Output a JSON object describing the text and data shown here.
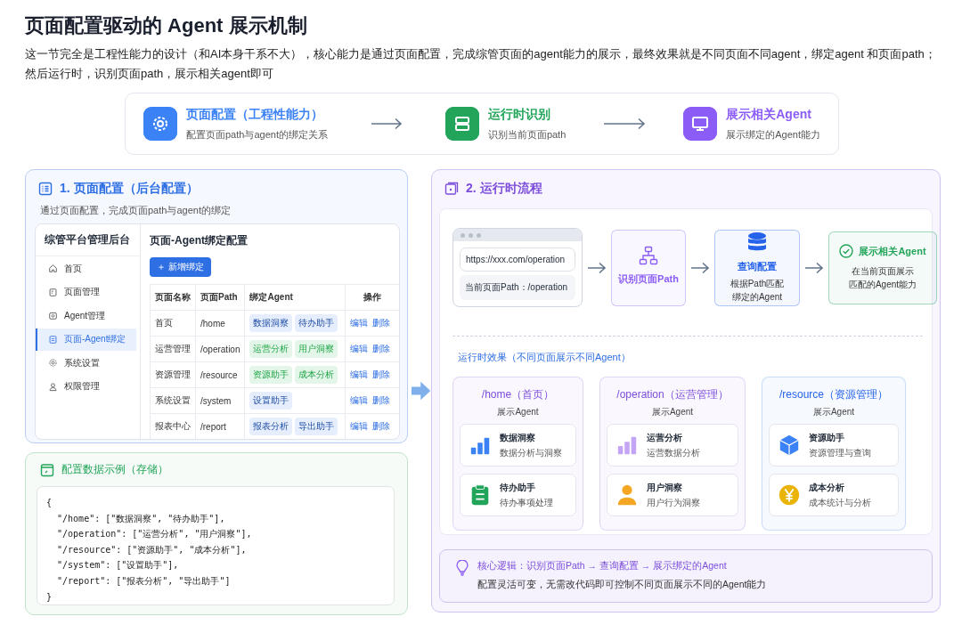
{
  "title": "页面配置驱动的 Agent 展示机制",
  "intro": "这一节完全是工程性能力的设计（和AI本身干系不大），核心能力是通过页面配置，完成综管页面的agent能力的展示，最终效果就是不同页面不同agent，绑定agent 和页面path；然后运行时，识别页面path，展示相关agent即可",
  "overview_steps": [
    {
      "title": "页面配置（工程性能力）",
      "desc": "配置页面path与agent的绑定关系",
      "color": "#3b82f6"
    },
    {
      "title": "运行时识别",
      "desc": "识别当前页面path",
      "color": "#22a55a"
    },
    {
      "title": "展示相关Agent",
      "desc": "展示绑定的Agent能力",
      "color": "#8b5cf6"
    }
  ],
  "config_panel": {
    "title": "1. 页面配置（后台配置）",
    "subtitle": "通过页面配置，完成页面path与agent的绑定",
    "admin": {
      "app_title": "综管平台管理后台",
      "sidebar": [
        {
          "label": "首页",
          "selected": false
        },
        {
          "label": "页面管理",
          "selected": false
        },
        {
          "label": "Agent管理",
          "selected": false
        },
        {
          "label": "页面-Agent绑定",
          "selected": true
        },
        {
          "label": "系统设置",
          "selected": false
        },
        {
          "label": "权限管理",
          "selected": false
        }
      ],
      "page_title": "页面-Agent绑定配置",
      "add_button": "＋ 新增绑定",
      "table": {
        "columns": [
          "页面名称",
          "页面Path",
          "绑定Agent",
          "操作"
        ],
        "rows": [
          {
            "name": "首页",
            "path": "/home",
            "agents": [
              {
                "label": "数据洞察",
                "color": "#e6eefd"
              },
              {
                "label": "待办助手",
                "color": "#e6eefd"
              }
            ],
            "actions": [
              "编辑",
              "删除"
            ]
          },
          {
            "name": "运营管理",
            "path": "/operation",
            "agents": [
              {
                "label": "运营分析",
                "color": "#e4f5e9"
              },
              {
                "label": "用户洞察",
                "color": "#e4f5e9"
              }
            ],
            "actions": [
              "编辑",
              "删除"
            ]
          },
          {
            "name": "资源管理",
            "path": "/resource",
            "agents": [
              {
                "label": "资源助手",
                "color": "#e4f5e9"
              },
              {
                "label": "成本分析",
                "color": "#e4f5e9"
              }
            ],
            "actions": [
              "编辑",
              "删除"
            ]
          },
          {
            "name": "系统设置",
            "path": "/system",
            "agents": [
              {
                "label": "设置助手",
                "color": "#e6eefd"
              }
            ],
            "actions": [
              "编辑",
              "删除"
            ]
          },
          {
            "name": "报表中心",
            "path": "/report",
            "agents": [
              {
                "label": "报表分析",
                "color": "#e6eefd"
              },
              {
                "label": "导出助手",
                "color": "#e6eefd"
              }
            ],
            "actions": [
              "编辑",
              "删除"
            ]
          }
        ]
      }
    }
  },
  "storage_panel": {
    "title": "配置数据示例（存储）",
    "code_lines": [
      "{",
      "  \"/home\": [\"数据洞察\", \"待办助手\"],",
      "  \"/operation\": [\"运营分析\", \"用户洞察\"],",
      "  \"/resource\": [\"资源助手\", \"成本分析\"],",
      "  \"/system\": [\"设置助手\"],",
      "  \"/report\": [\"报表分析\", \"导出助手\"]",
      "}"
    ]
  },
  "runtime_panel": {
    "title": "2. 运行时流程",
    "flow": [
      {
        "kind": "browser",
        "url": "https://xxx.com/operation",
        "path_label": "当前页面Path：/operation"
      },
      {
        "kind": "step",
        "title": "识别页面Path",
        "color": "#8b5cf6"
      },
      {
        "kind": "step",
        "title": "查询配置",
        "desc_lines": [
          "根据Path匹配",
          "绑定的Agent"
        ],
        "color": "#2563eb"
      },
      {
        "kind": "result",
        "title": "展示相关Agent",
        "desc_lines": [
          "在当前页面展示",
          "匹配的Agent能力"
        ],
        "color": "#22a55a"
      }
    ],
    "effect_title": "运行时效果（不同页面展示不同Agent）",
    "pages": [
      {
        "title": "/home（首页）",
        "subtitle": "展示Agent",
        "color": "#7c4ddb",
        "agents": [
          {
            "name": "数据洞察",
            "desc": "数据分析与洞察"
          },
          {
            "name": "待办助手",
            "desc": "待办事项处理"
          }
        ]
      },
      {
        "title": "/operation（运营管理）",
        "subtitle": "展示Agent",
        "color": "#7c4ddb",
        "agents": [
          {
            "name": "运营分析",
            "desc": "运营数据分析"
          },
          {
            "name": "用户洞察",
            "desc": "用户行为洞察"
          }
        ]
      },
      {
        "title": "/resource（资源管理）",
        "subtitle": "展示Agent",
        "color": "#2563eb",
        "agents": [
          {
            "name": "资源助手",
            "desc": "资源管理与查询"
          },
          {
            "name": "成本分析",
            "desc": "成本统计与分析"
          }
        ]
      }
    ],
    "note": {
      "title": "核心逻辑：识别页面Path → 查询配置 → 展示绑定的Agent",
      "text": "配置灵活可变，无需改代码即可控制不同页面展示不同的Agent能力"
    }
  }
}
